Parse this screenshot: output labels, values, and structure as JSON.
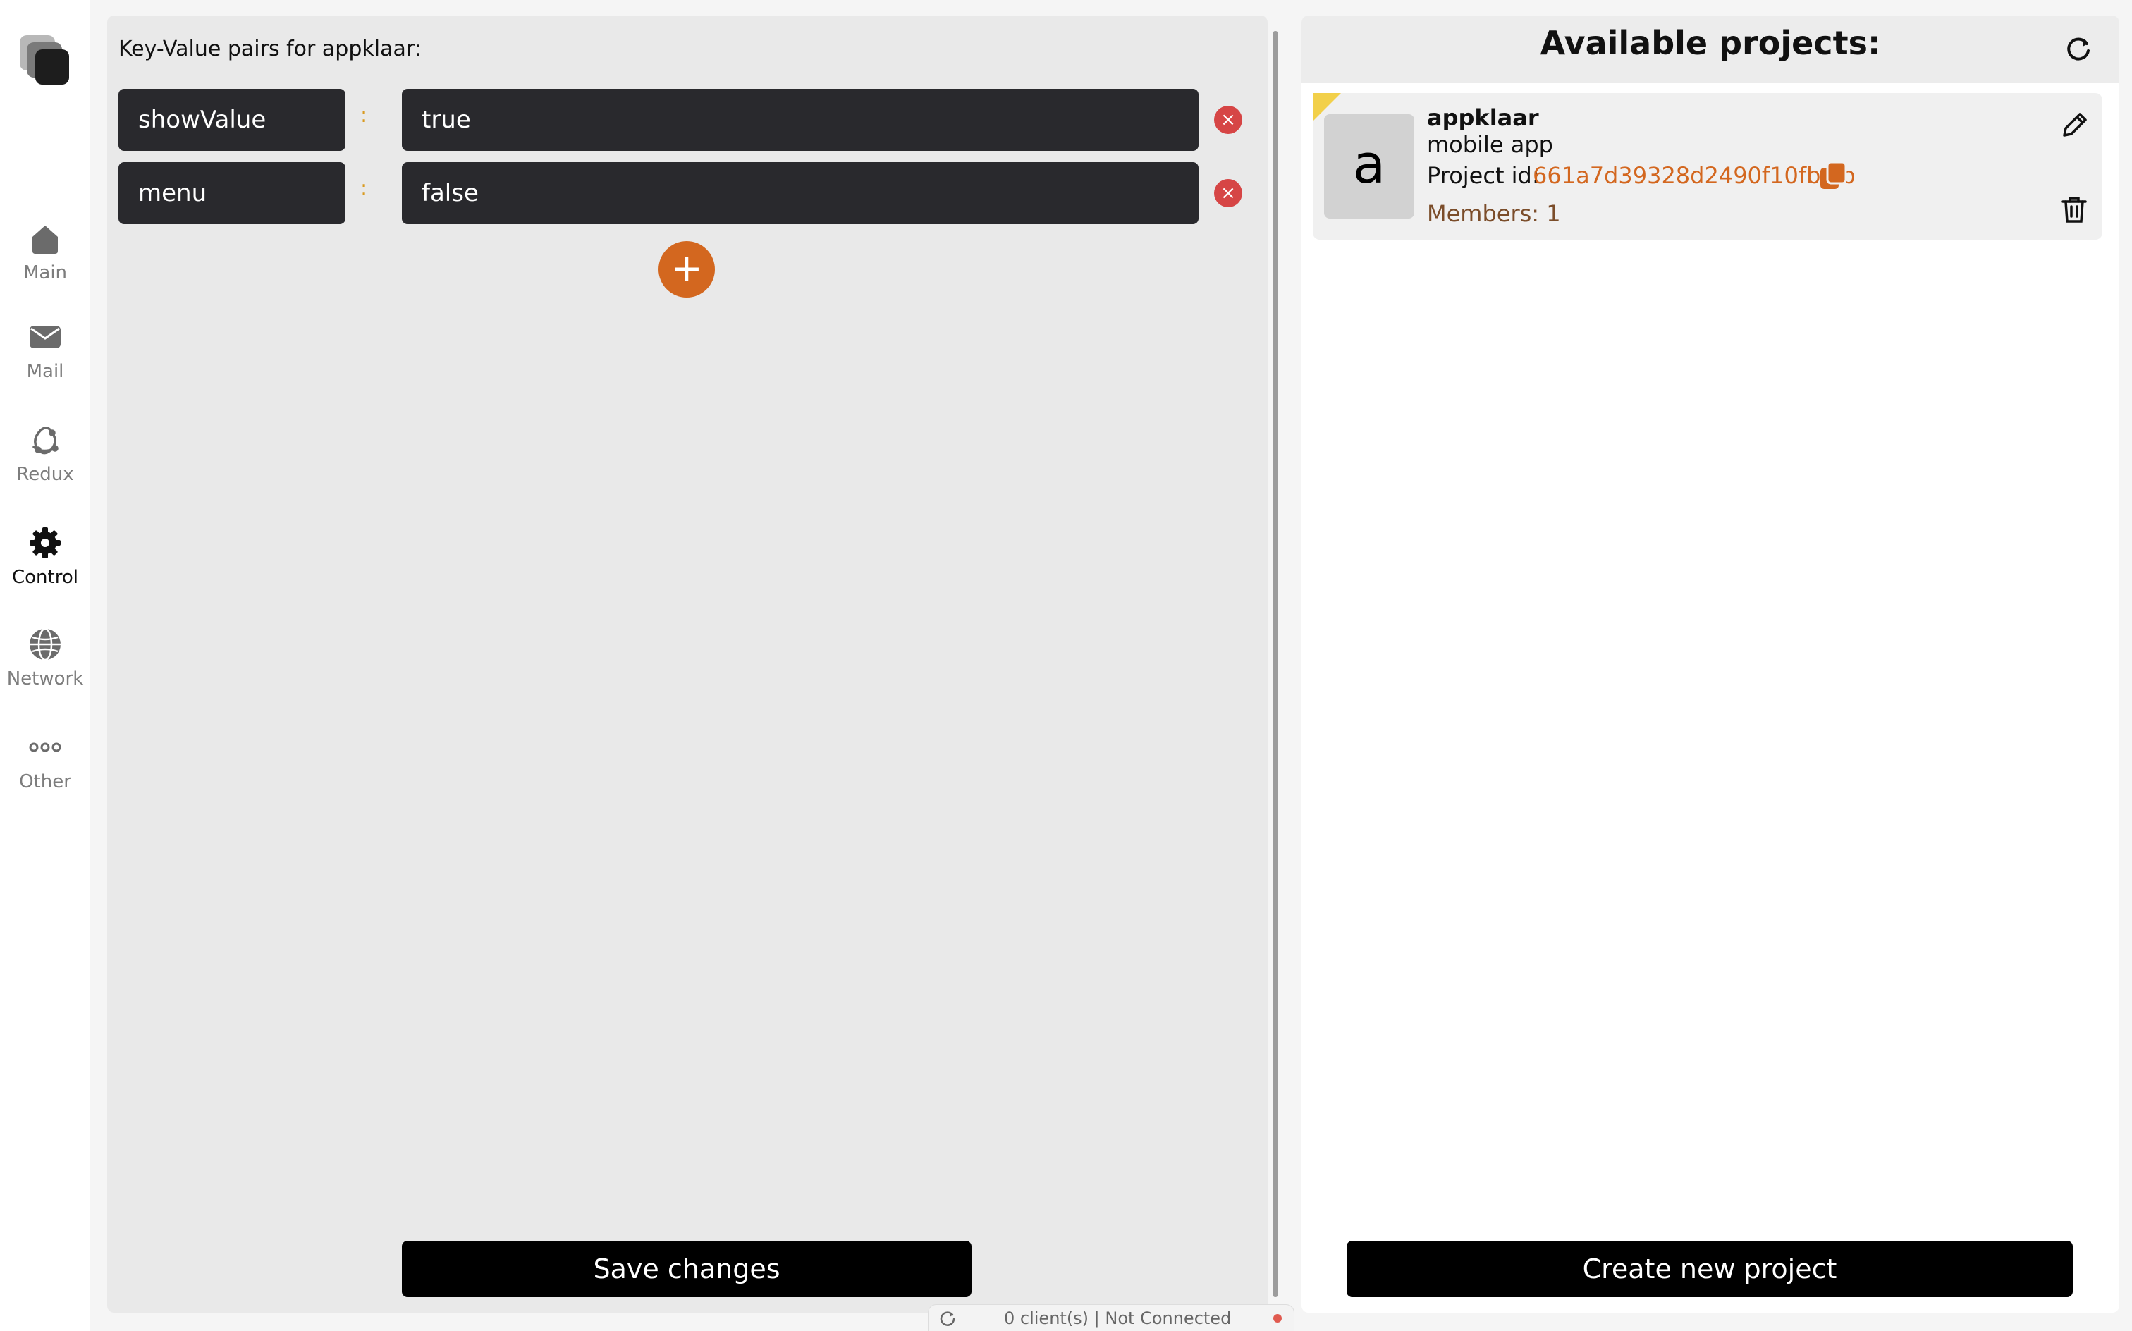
{
  "sidebar": {
    "items": [
      {
        "label": "Main",
        "icon": "home-icon"
      },
      {
        "label": "Mail",
        "icon": "mail-icon"
      },
      {
        "label": "Redux",
        "icon": "redux-icon"
      },
      {
        "label": "Control",
        "icon": "gear-icon",
        "active": true
      },
      {
        "label": "Network",
        "icon": "globe-icon"
      },
      {
        "label": "Other",
        "icon": "more-dots-icon"
      }
    ]
  },
  "editor": {
    "title": "Key-Value pairs for appklaar:",
    "separator": ":",
    "pairs": [
      {
        "key": "showValue",
        "value": "true"
      },
      {
        "key": "menu",
        "value": "false"
      }
    ],
    "add_label": "+",
    "delete_label": "×",
    "save_label": "Save changes"
  },
  "projects": {
    "title": "Available projects:",
    "items": [
      {
        "avatar_letter": "a",
        "name": "appklaar",
        "description": "mobile app",
        "id_label": "Project id:",
        "id": "661a7d39328d2490f10fbcfb",
        "members": "Members: 1"
      }
    ],
    "create_label": "Create new project"
  },
  "status": {
    "text": "0 client(s) | Not Connected",
    "indicator_color": "#e05a4f"
  },
  "colors": {
    "accent": "#d3671f",
    "danger": "#d64545",
    "input_bg": "#29292d",
    "flag": "#f2d04a"
  }
}
